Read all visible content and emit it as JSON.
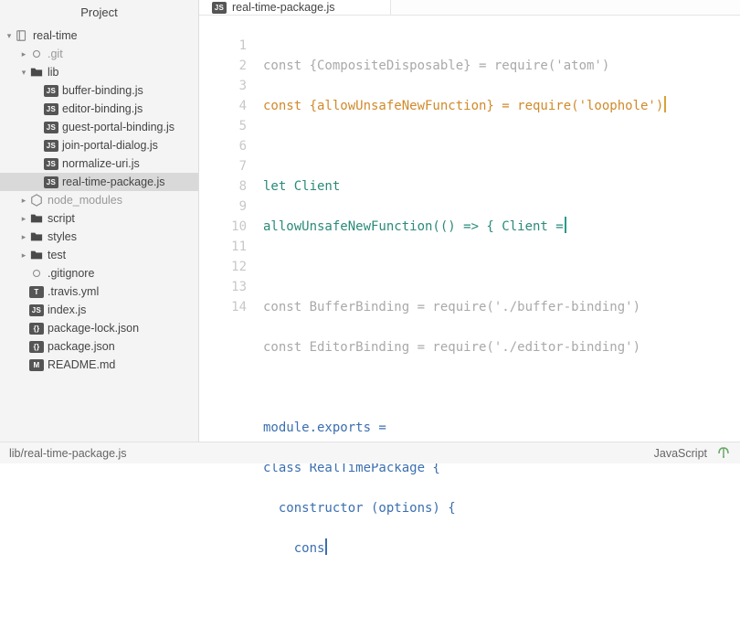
{
  "sidebar": {
    "title": "Project",
    "root": {
      "label": "real-time"
    },
    "items": [
      {
        "label": ".git"
      },
      {
        "label": "lib"
      },
      {
        "label": "buffer-binding.js"
      },
      {
        "label": "editor-binding.js"
      },
      {
        "label": "guest-portal-binding.js"
      },
      {
        "label": "join-portal-dialog.js"
      },
      {
        "label": "normalize-uri.js"
      },
      {
        "label": "real-time-package.js"
      },
      {
        "label": "node_modules"
      },
      {
        "label": "script"
      },
      {
        "label": "styles"
      },
      {
        "label": "test"
      },
      {
        "label": ".gitignore"
      },
      {
        "label": ".travis.yml"
      },
      {
        "label": "index.js"
      },
      {
        "label": "package-lock.json"
      },
      {
        "label": "package.json"
      },
      {
        "label": "README.md"
      }
    ]
  },
  "tabs": [
    {
      "label": "real-time-package.js"
    }
  ],
  "editor": {
    "line_numbers": [
      "1",
      "2",
      "3",
      "4",
      "5",
      "6",
      "7",
      "8",
      "9",
      "10",
      "11",
      "12",
      "13",
      "14"
    ],
    "lines": [
      "const {CompositeDisposable} = require('atom')",
      "const {allowUnsafeNewFunction} = require('loophole')",
      "",
      "let Client",
      "allowUnsafeNewFunction(() => { Client =",
      "",
      "const BufferBinding = require('./buffer-binding')",
      "const EditorBinding = require('./editor-binding')",
      "",
      "module.exports =",
      "class RealTimePackage {",
      "  constructor (options) {",
      "    cons",
      ""
    ]
  },
  "status": {
    "path": "lib/real-time-package.js",
    "language": "JavaScript"
  }
}
